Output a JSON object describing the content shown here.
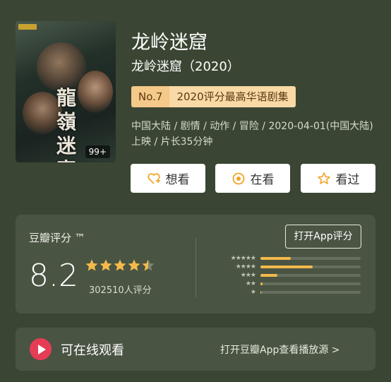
{
  "header": {
    "title": "龙岭迷窟",
    "subtitle": "龙岭迷窟（2020）",
    "rank_no": "No.7",
    "rank_label": "2020评分最高华语剧集",
    "meta": "中国大陆 / 剧情 / 动作 / 冒险 / 2020-04-01(中国大陆)上映 / 片长35分钟",
    "poster_badge": "99+",
    "poster_title_art": "龍嶺迷窟"
  },
  "actions": {
    "want": "想看",
    "watching": "在看",
    "watched": "看过"
  },
  "rating": {
    "label": "豆瓣评分 ™",
    "open_app": "打开App评分",
    "score": "8.2",
    "count": "302510人评分",
    "stars_filled": 4.5,
    "distribution": [
      {
        "stars": "★★★★★",
        "fraction": 0.3
      },
      {
        "stars": "★★★★",
        "fraction": 0.52
      },
      {
        "stars": "★★★",
        "fraction": 0.17
      },
      {
        "stars": "★★",
        "fraction": 0.02
      },
      {
        "stars": "★",
        "fraction": 0.01
      }
    ]
  },
  "online": {
    "title": "可在线观看",
    "link": "打开豆瓣App查看播放源 >"
  },
  "colors": {
    "background": "#3a4633",
    "card": "#4a5443",
    "star": "#f4ba4b",
    "play": "#e63c55"
  }
}
